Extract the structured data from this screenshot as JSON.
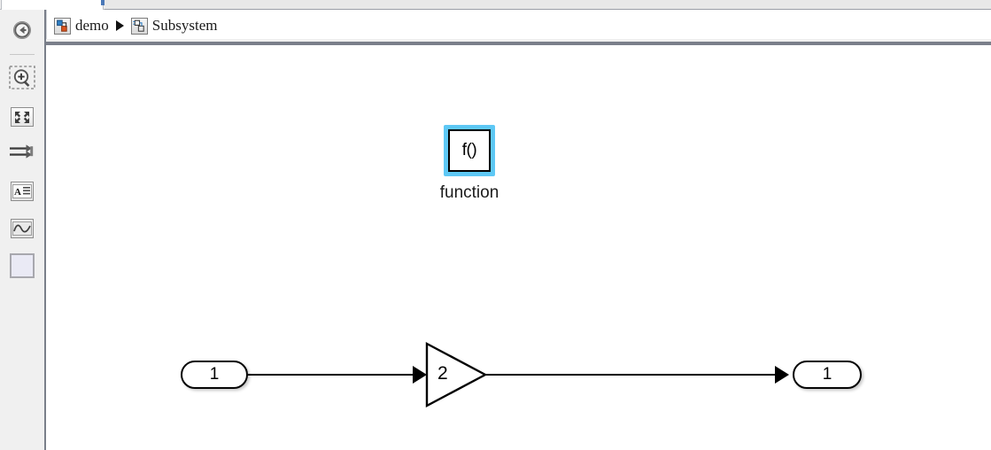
{
  "window": {
    "tab_strip_visible": true
  },
  "sidebar": {
    "items": [
      {
        "name": "navigate-back-icon",
        "label": "Back",
        "glyph": "back-arrow"
      },
      {
        "name": "zoom-in-icon",
        "label": "Zoom In",
        "glyph": "magnifier-plus"
      },
      {
        "name": "fit-to-view-icon",
        "label": "Fit To View",
        "glyph": "four-arrows-out"
      },
      {
        "name": "signal-arrows-icon",
        "label": "Signals",
        "glyph": "two-arrows-right"
      },
      {
        "name": "annotation-icon",
        "label": "Annotation",
        "glyph": "letter-a-lines"
      },
      {
        "name": "scope-icon",
        "label": "Scope",
        "glyph": "waveform-image"
      },
      {
        "name": "blank-block-icon",
        "label": "Block",
        "glyph": "empty-square"
      }
    ]
  },
  "breadcrumb": {
    "separator": "▶",
    "items": [
      {
        "label": "demo",
        "icon": "model-icon"
      },
      {
        "label": "Subsystem",
        "icon": "subsystem-icon"
      }
    ]
  },
  "canvas": {
    "function_block": {
      "text": "f()",
      "caption": "function",
      "selected": true,
      "selection_color": "#5ec8f5"
    },
    "inport": {
      "label": "1"
    },
    "gain": {
      "label": "2"
    },
    "outport": {
      "label": "1"
    }
  },
  "colors": {
    "selection": "#5ec8f5",
    "sidebar_bg": "#f0f0f0",
    "canvas_bg": "#ffffff",
    "divider": "#7a7f8a",
    "block_stroke": "#000000"
  }
}
